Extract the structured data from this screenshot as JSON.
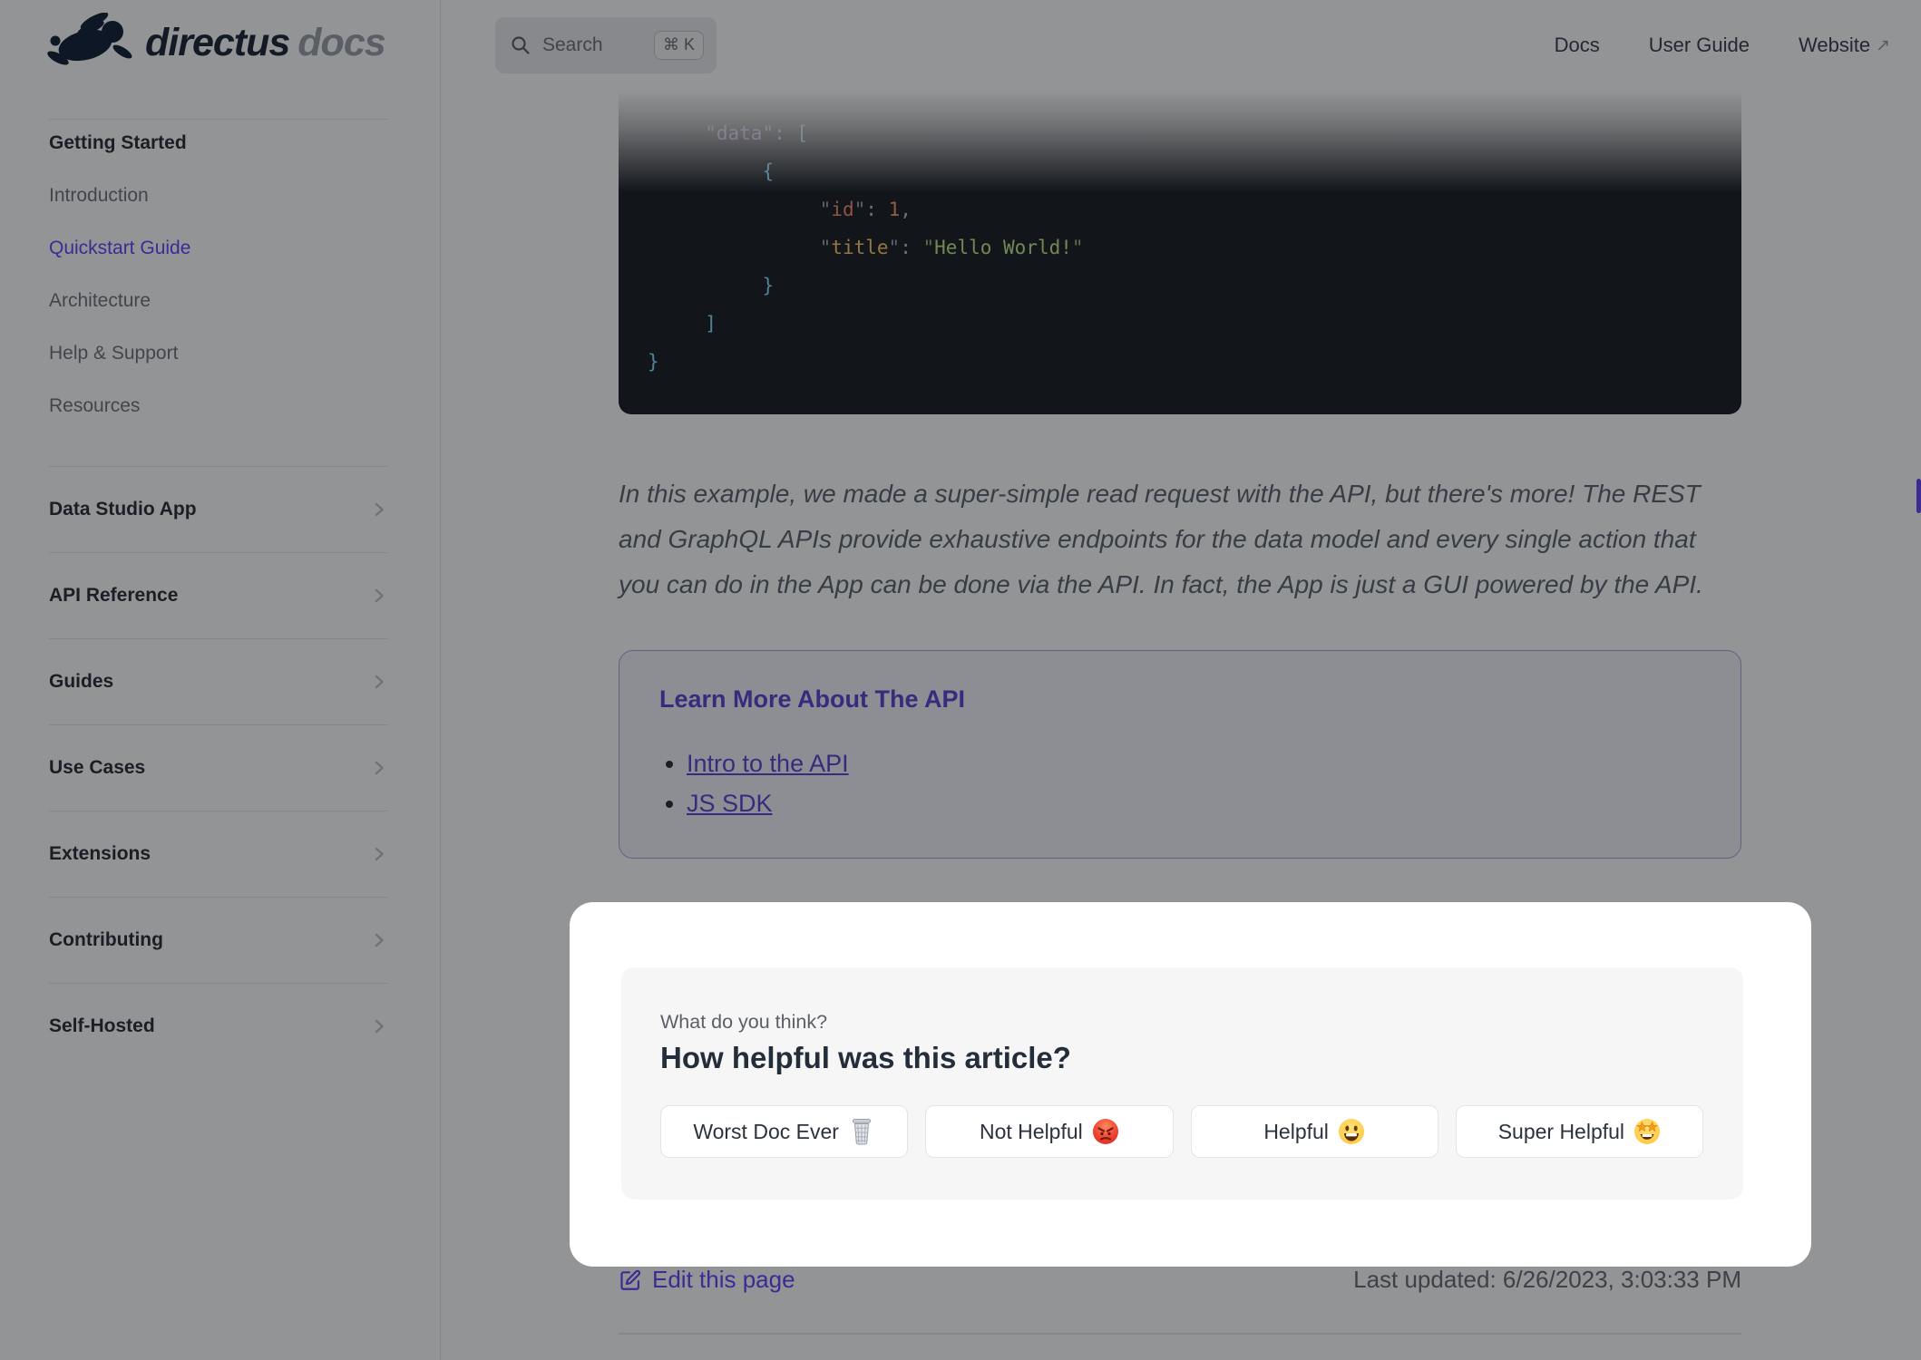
{
  "logo": {
    "brand": "directus",
    "suffix": "docs"
  },
  "header": {
    "search": {
      "label": "Search",
      "shortcut": "⌘ K"
    },
    "nav": [
      {
        "label": "Docs",
        "external": false
      },
      {
        "label": "User Guide",
        "external": false
      },
      {
        "label": "Website",
        "external": true
      }
    ]
  },
  "sidebar": {
    "section_title": "Getting Started",
    "items": [
      {
        "label": "Introduction",
        "active": false
      },
      {
        "label": "Quickstart Guide",
        "active": true
      },
      {
        "label": "Architecture",
        "active": false
      },
      {
        "label": "Help & Support",
        "active": false
      },
      {
        "label": "Resources",
        "active": false
      }
    ],
    "groups": [
      "Data Studio App",
      "API Reference",
      "Guides",
      "Use Cases",
      "Extensions",
      "Contributing",
      "Self-Hosted"
    ]
  },
  "code_block": {
    "language": "json",
    "lines": [
      [
        {
          "t": "     "
        },
        {
          "t": "\"",
          "c": "q"
        },
        {
          "t": "data",
          "c": "key1"
        },
        {
          "t": "\"",
          "c": "q"
        },
        {
          "t": ":",
          "c": "pn"
        },
        {
          "t": " "
        },
        {
          "t": "[",
          "c": "br"
        }
      ],
      [
        {
          "t": "          "
        },
        {
          "t": "{",
          "c": "br"
        }
      ],
      [
        {
          "t": "               "
        },
        {
          "t": "\"",
          "c": "q"
        },
        {
          "t": "id",
          "c": "key3a"
        },
        {
          "t": "\"",
          "c": "q"
        },
        {
          "t": ":",
          "c": "pn"
        },
        {
          "t": " "
        },
        {
          "t": "1",
          "c": "num"
        },
        {
          "t": ",",
          "c": "pn"
        }
      ],
      [
        {
          "t": "               "
        },
        {
          "t": "\"",
          "c": "q"
        },
        {
          "t": "title",
          "c": "key3b"
        },
        {
          "t": "\"",
          "c": "q"
        },
        {
          "t": ":",
          "c": "pn"
        },
        {
          "t": " "
        },
        {
          "t": "\"",
          "c": "qs"
        },
        {
          "t": "Hello World!",
          "c": "str"
        },
        {
          "t": "\"",
          "c": "qs"
        }
      ],
      [
        {
          "t": "          "
        },
        {
          "t": "}",
          "c": "br"
        }
      ],
      [
        {
          "t": "     "
        },
        {
          "t": "]",
          "c": "br"
        }
      ],
      [
        {
          "t": "}",
          "c": "br"
        }
      ]
    ]
  },
  "paragraph": "In this example, we made a super-simple read request with the API, but there's more! The REST and GraphQL APIs provide exhaustive endpoints for the data model and every single action that you can do in the App can be done via the API. In fact, the App is just a GUI powered by the API.",
  "callout": {
    "title": "Learn More About The API",
    "links": [
      "Intro to the API",
      "JS SDK"
    ]
  },
  "feedback": {
    "kicker": "What do you think?",
    "question": "How helpful was this article?",
    "buttons": [
      {
        "label": "Worst Doc Ever",
        "icon": "trash-emoji"
      },
      {
        "label": "Not Helpful",
        "icon": "angry-face-emoji"
      },
      {
        "label": "Helpful",
        "icon": "happy-face-emoji"
      },
      {
        "label": "Super Helpful",
        "icon": "star-struck-emoji"
      }
    ]
  },
  "footer": {
    "edit_label": "Edit this page",
    "last_updated": "Last updated: 6/26/2023, 3:03:33 PM"
  },
  "colors": {
    "brand_purple": "#6644ff",
    "callout_purple": "#5948d6",
    "code_bg": "#1c2027",
    "dim_overlay": "rgba(8,9,12,0.435)",
    "card_bg": "#f6f6f7"
  }
}
